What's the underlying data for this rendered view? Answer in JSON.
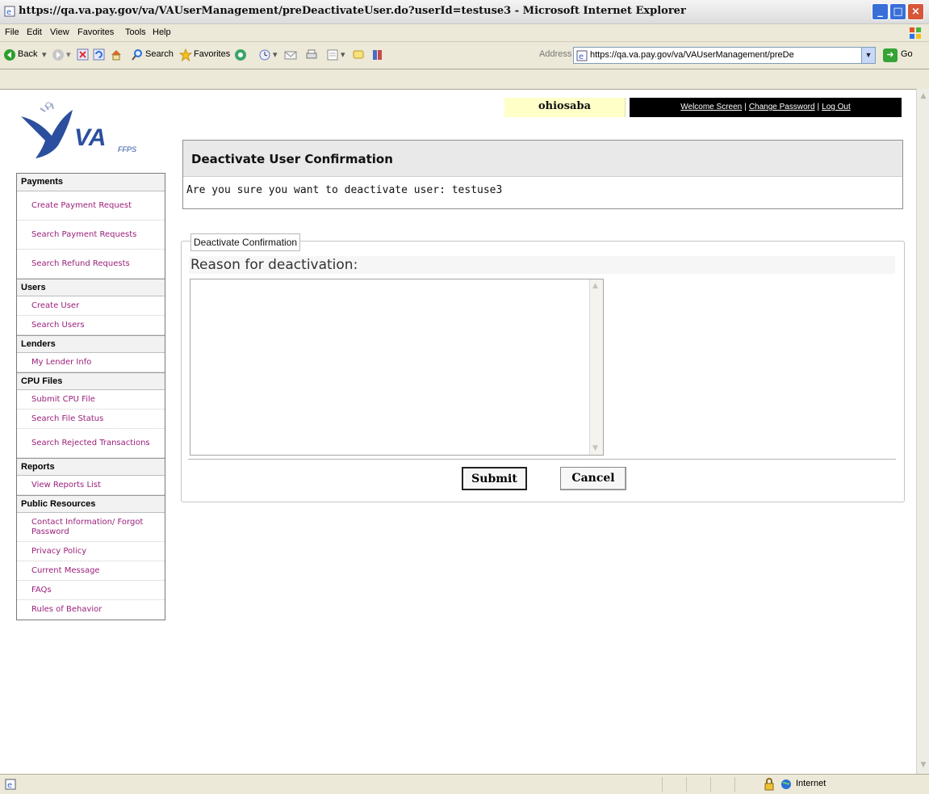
{
  "browser": {
    "title": "https://qa.va.pay.gov/va/VAUserManagement/preDeactivateUser.do?userId=testuse3 - Microsoft Internet Explorer",
    "menu": [
      "File",
      "Edit",
      "View",
      "Favorites",
      "Tools",
      "Help"
    ],
    "toolbar": {
      "back_label": "Back",
      "search_label": "Search",
      "favorites_label": "Favorites",
      "address_label": "Address",
      "address_value": "https://qa.va.pay.gov/va/VAUserManagement/preDe",
      "go_label": "Go"
    },
    "status": {
      "zone": "Internet"
    }
  },
  "logo": {
    "text": "VA",
    "subtext": "FFPS"
  },
  "header": {
    "username": "ohiosaba",
    "nav": [
      "Welcome Screen",
      "Change Password",
      "Log Out"
    ]
  },
  "sidebar": {
    "sections": [
      {
        "title": "Payments",
        "items": [
          "Create Payment Request",
          "Search Payment Requests",
          "Search Refund Requests"
        ]
      },
      {
        "title": "Users",
        "items": [
          "Create User",
          "Search Users"
        ]
      },
      {
        "title": "Lenders",
        "items": [
          "My Lender Info"
        ]
      },
      {
        "title": "CPU Files",
        "items": [
          "Submit CPU File",
          "Search File Status",
          "Search Rejected Transactions"
        ]
      },
      {
        "title": "Reports",
        "items": [
          "View Reports List"
        ]
      },
      {
        "title": "Public Resources",
        "items": [
          "Contact Information/ Forgot Password",
          "Privacy Policy",
          "Current Message",
          "FAQs",
          "Rules of Behavior"
        ]
      }
    ]
  },
  "confirmation": {
    "heading": "Deactivate User Confirmation",
    "message": "Are you sure you want to deactivate user: testuse3"
  },
  "form": {
    "legend": "Deactivate Confirmation",
    "reason_label": "Reason for deactivation:",
    "reason_value": "",
    "submit_label": "Submit",
    "cancel_label": "Cancel"
  }
}
